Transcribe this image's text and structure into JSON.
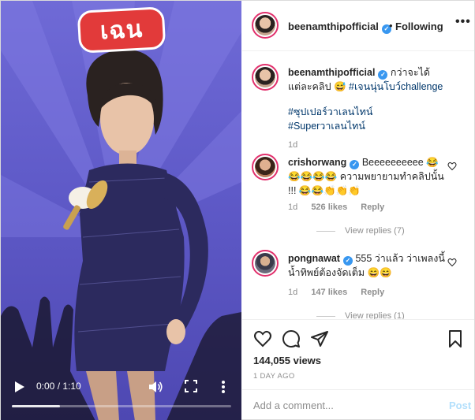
{
  "video": {
    "overlay_logo_text": "เฉน",
    "time": "0:00 / 1:10",
    "progress": 0.22
  },
  "header": {
    "username": "beenamthipofficial",
    "separator": "•",
    "follow_label": "Following",
    "more_label": "•••"
  },
  "caption": {
    "username": "beenamthipofficial",
    "text": "กว่าจะได้แต่ละคลิป 😅 ",
    "tag1": "#เจนนุ่นโบว์challenge",
    "tags2": "#ซุปเปอร์วาเลนไทน์ #Superวาเลนไทน์",
    "time": "1d"
  },
  "comments": [
    {
      "username": "crishorwang",
      "text": "Beeeeeeeeee 😂😂😂😂😂 ความพยายามทำคลิปนั้น !!! 😂😂👏👏👏",
      "time": "1d",
      "likes": "526 likes",
      "reply": "Reply",
      "view_replies": "View replies (7)"
    },
    {
      "username": "pongnawat",
      "text": "555 ว่าแล้ว ว่าเพลงนี้ น้ำทิพย์ต้องจัดเต็ม 😄😄",
      "time": "1d",
      "likes": "147 likes",
      "reply": "Reply",
      "view_replies": "View replies (1)"
    }
  ],
  "actions": {
    "views": "144,055 views",
    "date": "1 DAY AGO"
  },
  "add_comment": {
    "placeholder": "Add a comment...",
    "post_label": "Post"
  },
  "colors": {
    "verified": "#3897f0",
    "link": "#00376b",
    "video_bg": "#5f5ac8",
    "logo_red": "#e23a3a",
    "post_disabled": "#b2dffc"
  }
}
